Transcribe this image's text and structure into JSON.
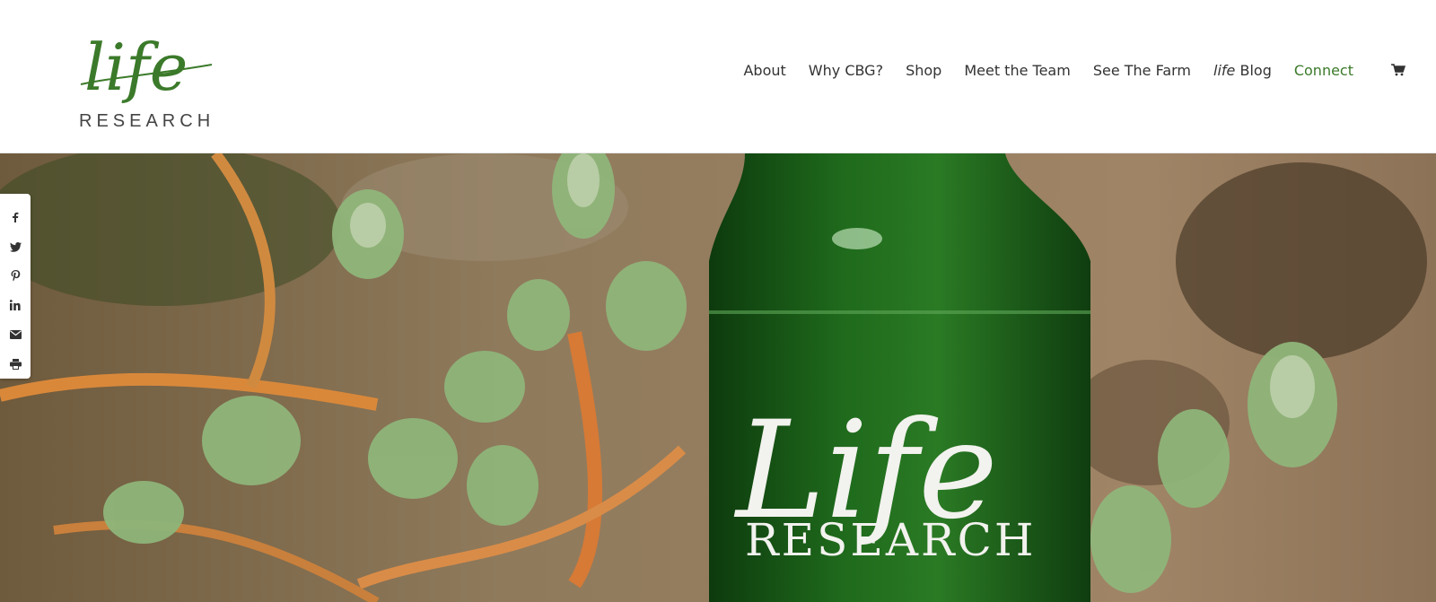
{
  "header": {
    "logo": {
      "script_text": "life",
      "wordmark": "RESEARCH"
    },
    "nav": [
      {
        "label": "About"
      },
      {
        "label": "Why CBG?"
      },
      {
        "label": "Shop"
      },
      {
        "label": "Meet the Team"
      },
      {
        "label": "See The Farm"
      },
      {
        "label_italic": "life",
        "label": " Blog"
      },
      {
        "label": "Connect",
        "active": true
      }
    ],
    "cart_icon": "shopping-cart-icon"
  },
  "hero": {
    "bottle_label": {
      "script_text": "Life",
      "wordmark": "RESEARCH"
    }
  },
  "share_bar": {
    "icons": [
      "facebook-icon",
      "twitter-icon",
      "pinterest-icon",
      "linkedin-icon",
      "email-icon",
      "print-icon"
    ]
  },
  "colors": {
    "brand_green": "#3b7a2a",
    "nav_text": "#333333",
    "bottle_green": "#1f5a1a"
  }
}
